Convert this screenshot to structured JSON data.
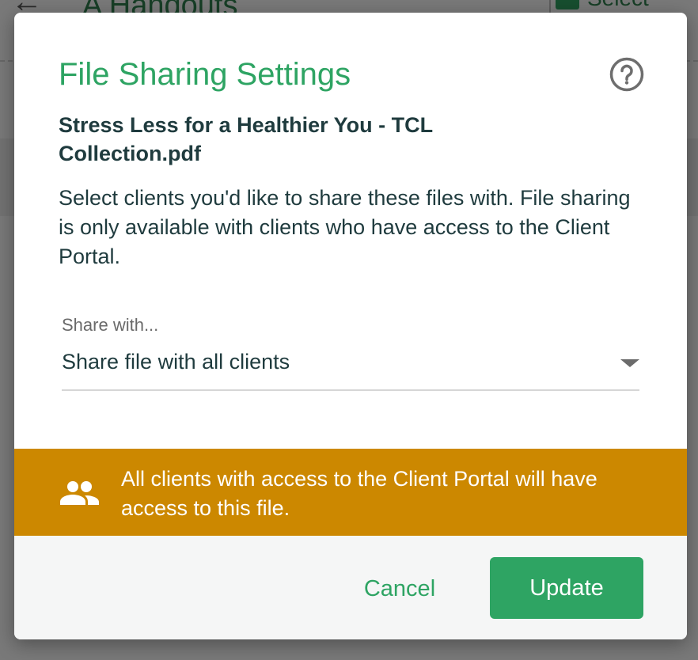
{
  "background": {
    "page_title": "A  Handouts",
    "back_glyph": "←",
    "select_label": "Select"
  },
  "dialog": {
    "title": "File Sharing Settings",
    "help_icon": "help-circle-icon",
    "file_name": "Stress Less for a Healthier You - TCL Collection.pdf",
    "description": "Select clients you'd like to share these files with. File sharing is only available with clients who have access to the Client Portal.",
    "share_with": {
      "label": "Share with...",
      "selected": "Share file with all clients"
    },
    "notice": {
      "icon": "people-icon",
      "text": "All clients with access to the Client Portal will have access to this file.",
      "color": "#cc8800"
    },
    "footer": {
      "cancel_label": "Cancel",
      "update_label": "Update"
    },
    "colors": {
      "accent": "#2ea463",
      "text": "#1f3b3e"
    }
  }
}
